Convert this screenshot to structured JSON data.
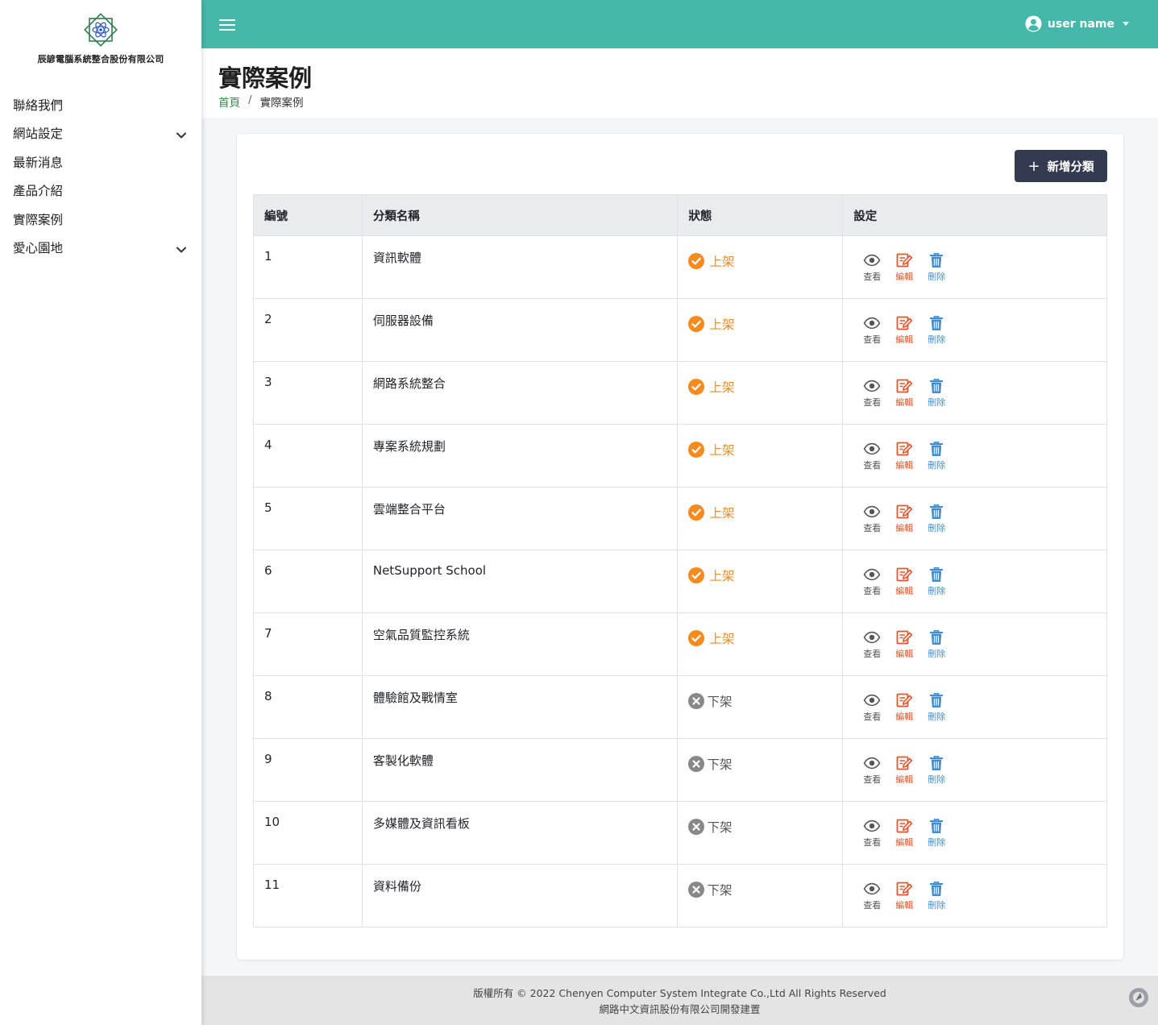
{
  "brand": {
    "name": "辰諺電腦系統整合股份有限公司",
    "logo_text": ""
  },
  "sidebar": {
    "items": [
      {
        "label": "聯絡我們",
        "has_children": false
      },
      {
        "label": "網站設定",
        "has_children": true
      },
      {
        "label": "最新消息",
        "has_children": false
      },
      {
        "label": "產品介紹",
        "has_children": false
      },
      {
        "label": "實際案例",
        "has_children": false
      },
      {
        "label": "愛心園地",
        "has_children": true
      }
    ]
  },
  "header": {
    "user_name": "user name"
  },
  "page": {
    "title": "實際案例",
    "breadcrumb": {
      "home": "首頁",
      "separator": "/",
      "current": "實際案例"
    }
  },
  "toolbar": {
    "add_label": "新增分類",
    "add_icon": "+"
  },
  "table": {
    "headers": [
      "編號",
      "分類名稱",
      "狀態",
      "設定"
    ],
    "rows": [
      {
        "id": "1",
        "name": "資訊軟體",
        "status": "上架",
        "active": true
      },
      {
        "id": "2",
        "name": "伺服器設備",
        "status": "上架",
        "active": true
      },
      {
        "id": "3",
        "name": "網路系統整合",
        "status": "上架",
        "active": true
      },
      {
        "id": "4",
        "name": "專案系統規劃",
        "status": "上架",
        "active": true
      },
      {
        "id": "5",
        "name": "雲端整合平台",
        "status": "上架",
        "active": true
      },
      {
        "id": "6",
        "name": "NetSupport School",
        "status": "上架",
        "active": true
      },
      {
        "id": "7",
        "name": "空氣品質監控系統",
        "status": "上架",
        "active": true
      },
      {
        "id": "8",
        "name": "體驗館及戰情室",
        "status": "下架",
        "active": false
      },
      {
        "id": "9",
        "name": "客製化軟體",
        "status": "下架",
        "active": false
      },
      {
        "id": "10",
        "name": "多媒體及資訊看板",
        "status": "下架",
        "active": false
      },
      {
        "id": "11",
        "name": "資料備份",
        "status": "下架",
        "active": false
      }
    ],
    "actions": {
      "view": "查看",
      "edit": "編輯",
      "delete": "刪除"
    }
  },
  "footer": {
    "line1": "版權所有 © 2022 Chenyen Computer System Integrate Co.,Ltd All Rights Reserved",
    "line2": "網路中文資訊股份有限公司開發建置"
  },
  "colors": {
    "topbar": "#45b8ab",
    "status_on": "#f58a1f",
    "status_off": "#888888",
    "edit": "#e8532b",
    "delete": "#3f8fd2",
    "add_button": "#343a50"
  }
}
